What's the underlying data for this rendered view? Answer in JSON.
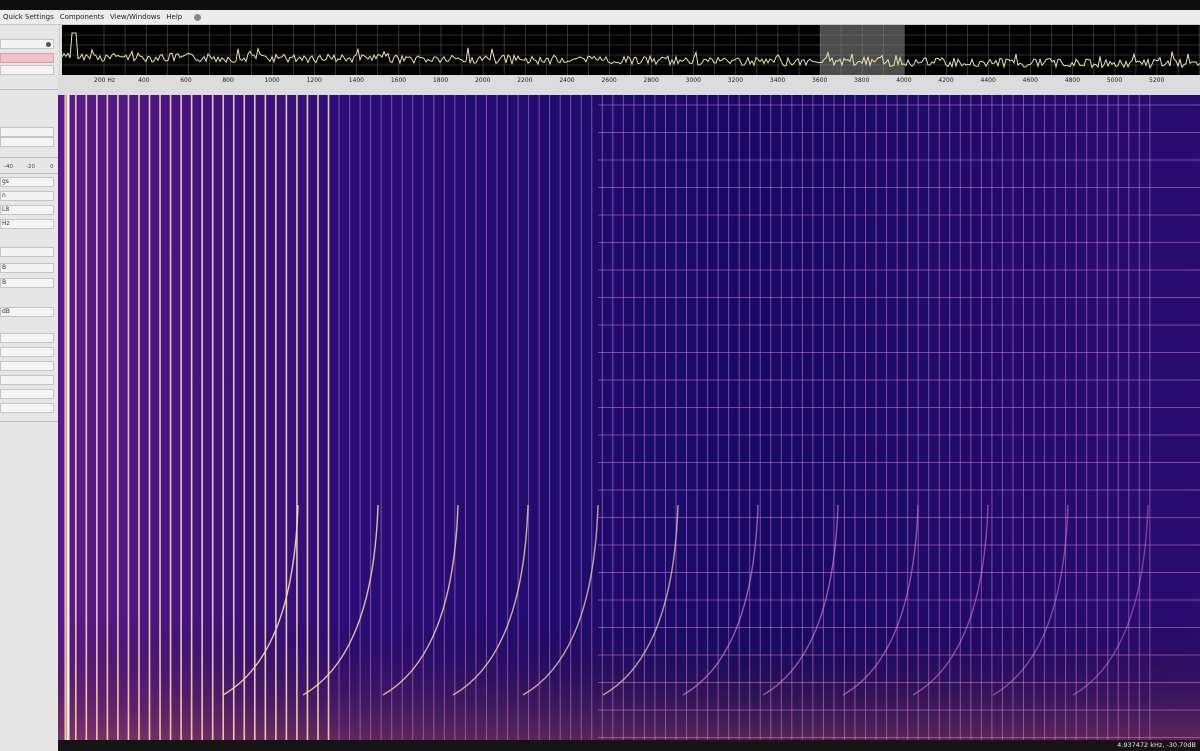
{
  "menubar": {
    "items": [
      "Quick Settings",
      "Components",
      "View/Windows",
      "Help"
    ]
  },
  "sidebar": {
    "scale_labels": [
      "-40",
      "-20",
      "0"
    ],
    "fragments": [
      "gs",
      "n",
      "L8",
      "Hz",
      "B",
      "B",
      "dB"
    ]
  },
  "spectrum": {
    "frequency_axis": {
      "labels": [
        "200 Hz",
        "400",
        "600",
        "800",
        "1000",
        "1200",
        "1400",
        "1600",
        "1800",
        "2000",
        "2200",
        "2400",
        "2600",
        "2800",
        "3000",
        "3200",
        "3400",
        "3600",
        "3800",
        "4000",
        "4200",
        "4400",
        "4600",
        "4800",
        "5000",
        "5200"
      ],
      "unit": "Hz"
    },
    "highlight_range_hz": [
      3600,
      4000
    ],
    "trace_color": "#e8e6a0"
  },
  "waterfall": {
    "background_color": "#1a0a5c",
    "line_color": "#ffd7a8"
  },
  "status": {
    "readout": "4.937472 kHz, -30.70dB"
  }
}
